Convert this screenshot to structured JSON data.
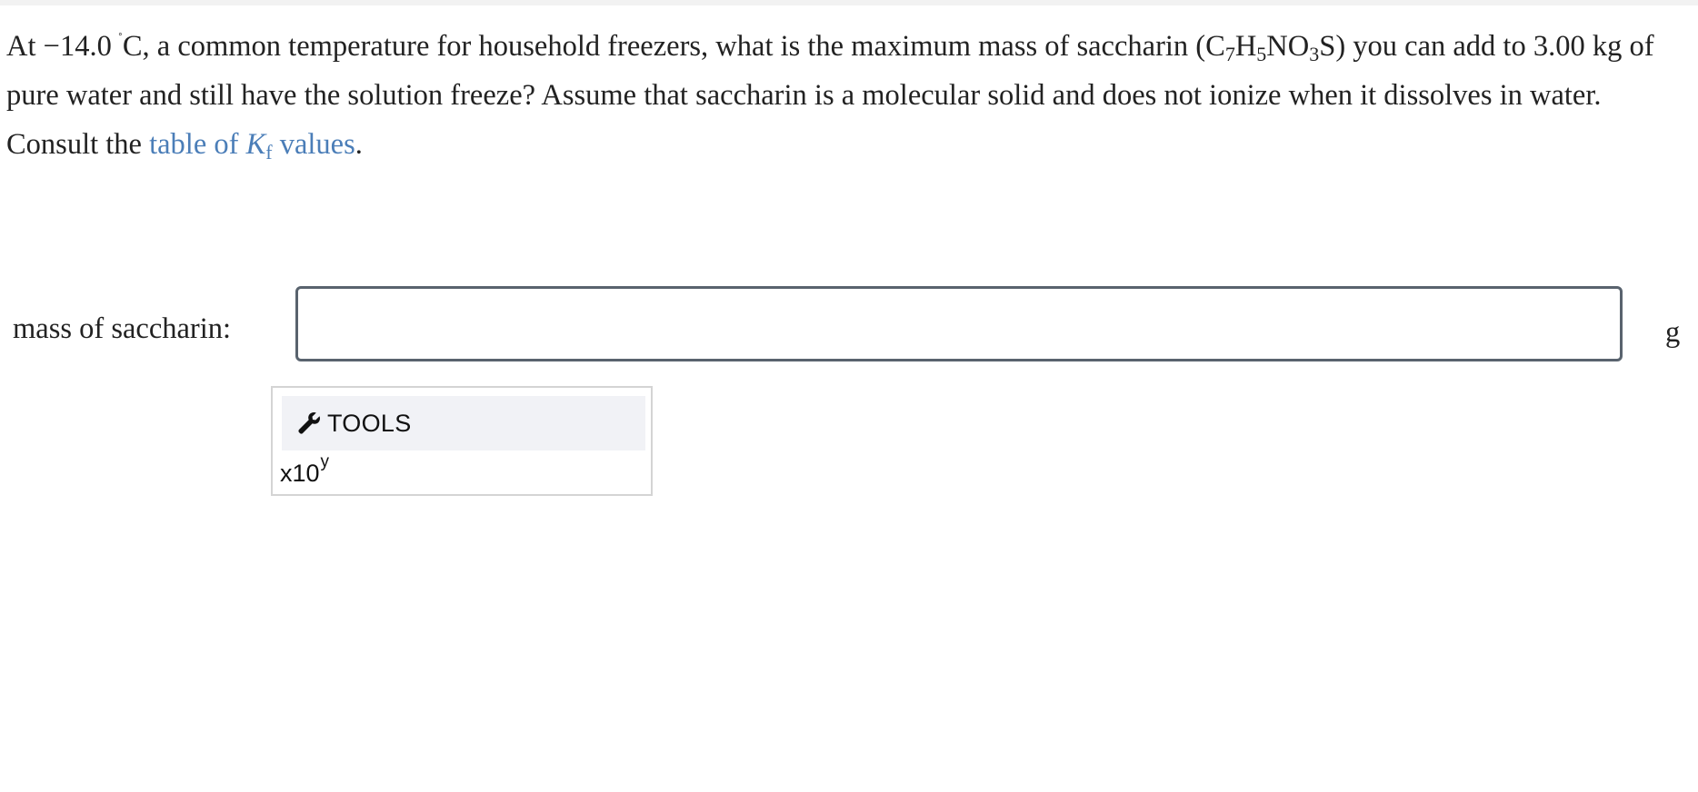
{
  "question": {
    "part1": "At −14.0",
    "degree": "˚",
    "part2": "C, a common temperature for household freezers, what is the maximum mass of saccharin (C",
    "sub1": "7",
    "part3": "H",
    "sub2": "5",
    "part4": "NO",
    "sub3": "3",
    "part5": "S) you can add to 3.00 kg of pure water and still have the solution freeze? Assume that saccharin is a molecular solid and does not ionize when it dissolves in water. Consult the ",
    "link_prefix": "table of ",
    "link_symbol": "K",
    "link_sub": "f",
    "link_suffix": " values",
    "end": "."
  },
  "answer": {
    "label": "mass of saccharin:",
    "value": "",
    "placeholder": "",
    "unit": "g"
  },
  "tools": {
    "header_label": "TOOLS",
    "icon": "wrench-icon",
    "sci_notation_base": "x10",
    "sci_notation_exp": "y"
  },
  "colors": {
    "link": "#4b7eb8",
    "input_border": "#59636e",
    "tools_header_bg": "#f1f2f6"
  }
}
